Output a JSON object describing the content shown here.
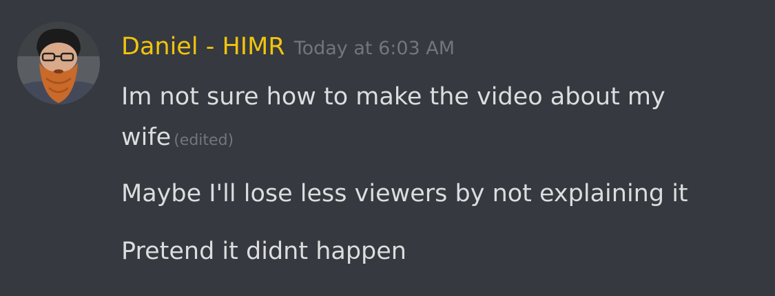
{
  "message": {
    "author": {
      "name": "Daniel - HIMR",
      "name_color": "#f1c40f",
      "avatar": "bearded-man-avatar"
    },
    "timestamp": "Today at 6:03 AM",
    "lines": [
      {
        "line1": "Im not sure how to make the video about my",
        "line2": "wife",
        "edited_label": "(edited)"
      },
      {
        "text": "Maybe I'll lose less viewers by not explaining it"
      },
      {
        "text": "Pretend it didnt happen"
      }
    ]
  },
  "colors": {
    "background": "#36393f",
    "text": "#dcddde",
    "muted": "#72767d"
  }
}
